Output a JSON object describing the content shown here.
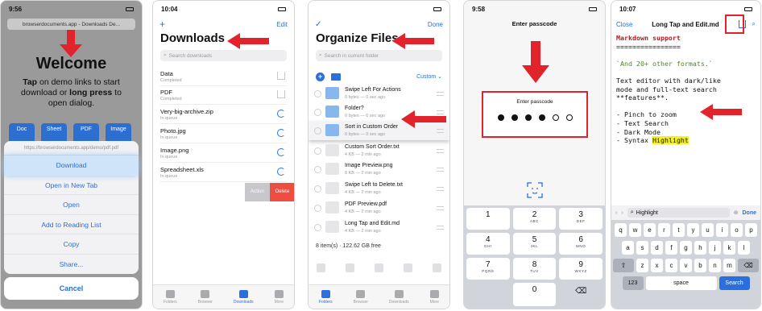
{
  "colors": {
    "accent": "#2a6fdb",
    "annotation_red": "#e3232b",
    "delete_red": "#ef4d3f",
    "markdown_heading": "#b71b1b",
    "highlight": "#f4f21a"
  },
  "phone1": {
    "time": "9:56",
    "url": "browserdocuments.app - Downloads De...",
    "welcome": "Welcome",
    "intro_a": "Tap",
    "intro_b": " on demo links to start download or ",
    "intro_c": "long press",
    "intro_d": " to open dialog.",
    "chips": [
      "Doc",
      "Sheet",
      "PDF",
      "Image"
    ],
    "sheet_url": "https://browserdocuments.app/demo/pdf.pdf",
    "actions": [
      "Download",
      "Open in New Tab",
      "Open",
      "Add to Reading List",
      "Copy",
      "Share..."
    ],
    "cancel": "Cancel"
  },
  "phone2": {
    "time": "10:04",
    "add_icon": "plus-icon",
    "edit": "Edit",
    "title": "Downloads",
    "search_placeholder": "Search downloads",
    "rows": [
      {
        "name": "Data",
        "status": "Completed",
        "icon": "download-tray-icon"
      },
      {
        "name": "PDF",
        "status": "Completed",
        "icon": "download-tray-icon"
      },
      {
        "name": "Very-big-archive.zip",
        "status": "In queue",
        "icon": "progress-ring-icon"
      },
      {
        "name": "Photo.jpg",
        "status": "In queue",
        "icon": "progress-ring-icon"
      },
      {
        "name": "Image.png",
        "status": "In queue",
        "icon": "progress-ring-icon"
      },
      {
        "name": "Spreadsheet.xls",
        "status": "In queue",
        "icon": "progress-ring-icon"
      }
    ],
    "swipe_action": "Action",
    "swipe_delete": "Delete",
    "tabs": [
      "Folders",
      "Browser",
      "Downloads",
      "More"
    ]
  },
  "phone3": {
    "check_icon": "checkmark-icon",
    "done": "Done",
    "title": "Organize Files",
    "search_placeholder": "Search in current folder",
    "sort": "Custom",
    "rows": [
      {
        "name": "Swipe Left For Actions",
        "meta": "0 bytes — 0 sec ago",
        "type": "folder"
      },
      {
        "name": "Folder?",
        "meta": "0 bytes — 0 sec ago",
        "type": "folder"
      },
      {
        "name": "Sort in Custom Order",
        "meta": "0 bytes — 0 sec ago",
        "type": "folder"
      },
      {
        "name": "Custom Sort Order.txt",
        "meta": "4 KB — 2 min ago",
        "type": "file"
      },
      {
        "name": "Image Preview.png",
        "meta": "8 KB — 2 min ago",
        "type": "file"
      },
      {
        "name": "Swipe Left to Delete.txt",
        "meta": "4 KB — 2 min ago",
        "type": "file"
      },
      {
        "name": "PDF Preview.pdf",
        "meta": "4 KB — 2 min ago",
        "type": "file"
      },
      {
        "name": "Long Tap and Edit.md",
        "meta": "4 KB — 2 min ago",
        "type": "file"
      }
    ],
    "footer": "8 item(s) · 122.62 GB free",
    "tabs": [
      "Folders",
      "Browser",
      "Downloads",
      "More"
    ]
  },
  "phone4": {
    "time": "9:58",
    "header": "Enter passcode",
    "box_label": "Enter passcode",
    "filled": 4,
    "total": 6,
    "keys": [
      {
        "n": "1",
        "l": ""
      },
      {
        "n": "2",
        "l": "ABC"
      },
      {
        "n": "3",
        "l": "DEF"
      },
      {
        "n": "4",
        "l": "GHI"
      },
      {
        "n": "5",
        "l": "JKL"
      },
      {
        "n": "6",
        "l": "MNO"
      },
      {
        "n": "7",
        "l": "PQRS"
      },
      {
        "n": "8",
        "l": "TUV"
      },
      {
        "n": "9",
        "l": "WXYZ"
      },
      {
        "n": "",
        "l": ""
      },
      {
        "n": "0",
        "l": ""
      },
      {
        "n": "⌫",
        "l": ""
      }
    ]
  },
  "phone5": {
    "time": "10:07",
    "close": "Close",
    "title": "Long Tap and Edit.md",
    "md_heading": "Markdown support",
    "md_rule": "================",
    "md_code": "`And 20+ other formats.`",
    "md_line1": "Text editor with dark/like",
    "md_line2": "mode and full-text search",
    "md_line3": "**features**.",
    "md_list": [
      "- Pinch to zoom",
      "- Text Search",
      "- Dark Mode"
    ],
    "md_last_prefix": "- Syntax ",
    "md_last_hl": "Highlight",
    "find_text": "Highlight",
    "find_done": "Done",
    "kb_row1": [
      "q",
      "w",
      "e",
      "r",
      "t",
      "y",
      "u",
      "i",
      "o",
      "p"
    ],
    "kb_row2": [
      "a",
      "s",
      "d",
      "f",
      "g",
      "h",
      "j",
      "k",
      "l"
    ],
    "kb_row3": [
      "z",
      "x",
      "c",
      "v",
      "b",
      "n",
      "m"
    ],
    "kb_num": "123",
    "kb_space": "space",
    "kb_search": "Search"
  }
}
